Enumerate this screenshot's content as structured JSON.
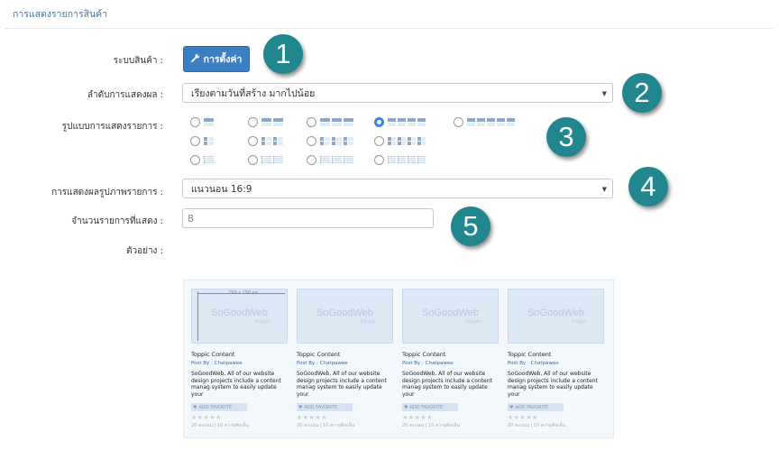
{
  "page": {
    "title": "การแสดงรายการสินค้า"
  },
  "form": {
    "system_label": "ระบบสินค้า :",
    "settings_button": "การตั้งค่า",
    "sort_label": "ลำดับการแสดงผล :",
    "sort_value": "เรียงตามวันที่สร้าง มากไปน้อย",
    "layout_label": "รูปแบบการแสดงรายการ :",
    "layout_selected": "4 columns - thumbnail",
    "image_label": "การแสดงผลรูปภาพรายการ :",
    "image_value": "แนวนอน 16:9",
    "count_label": "จำนวนรายการที่แสดง :",
    "count_value": "8",
    "preview_label": "ตัวอย่าง :"
  },
  "badges": [
    "1",
    "2",
    "3",
    "4",
    "5"
  ],
  "preview": {
    "cards": [
      {
        "watermark": "SoGoodWeb",
        "watermark_sub": "Picture",
        "dimension": "250 x 150 px",
        "title": "Toppic Content",
        "by": "Post By : Chatpawee",
        "desc": "SoGoodWeb, All of our website design projects include a content manag system to easily update your",
        "fav": "ADD FAVORITE",
        "stars": "★★★★★",
        "meta": "20 คะแนน | 10 ความคิดเห็น"
      },
      {
        "watermark": "SoGoodWeb",
        "watermark_sub": "Picture",
        "title": "Toppic Content",
        "by": "Post By : Chatpawee",
        "desc": "SoGoodWeb, All of our website design projects include a content manag system to easily update your",
        "fav": "ADD FAVORITE",
        "stars": "★★★★★",
        "meta": "20 คะแนน | 10 ความคิดเห็น"
      },
      {
        "watermark": "SoGoodWeb",
        "watermark_sub": "Picture",
        "title": "Toppic Content",
        "by": "Post By : Chatpawee",
        "desc": "SoGoodWeb, All of our website design projects include a content manag system to easily update your",
        "fav": "ADD FAVORITE",
        "stars": "★★★★★",
        "meta": "20 คะแนน | 10 ความคิดเห็น"
      },
      {
        "watermark": "SoGoodWeb",
        "watermark_sub": "Picture",
        "title": "Toppic Content",
        "by": "Post By : Chatpawee",
        "desc": "SoGoodWeb, All of our website design projects include a content manag system to easily update your",
        "fav": "ADD FAVORITE",
        "stars": "★★★★★",
        "meta": "20 คะแนน | 10 ความคิดเห็น"
      }
    ]
  },
  "colors": {
    "accent": "#3b7fc4",
    "badge": "#22868f",
    "icon_dark": "#8aa8cc",
    "icon_light": "#c4d6ea"
  }
}
